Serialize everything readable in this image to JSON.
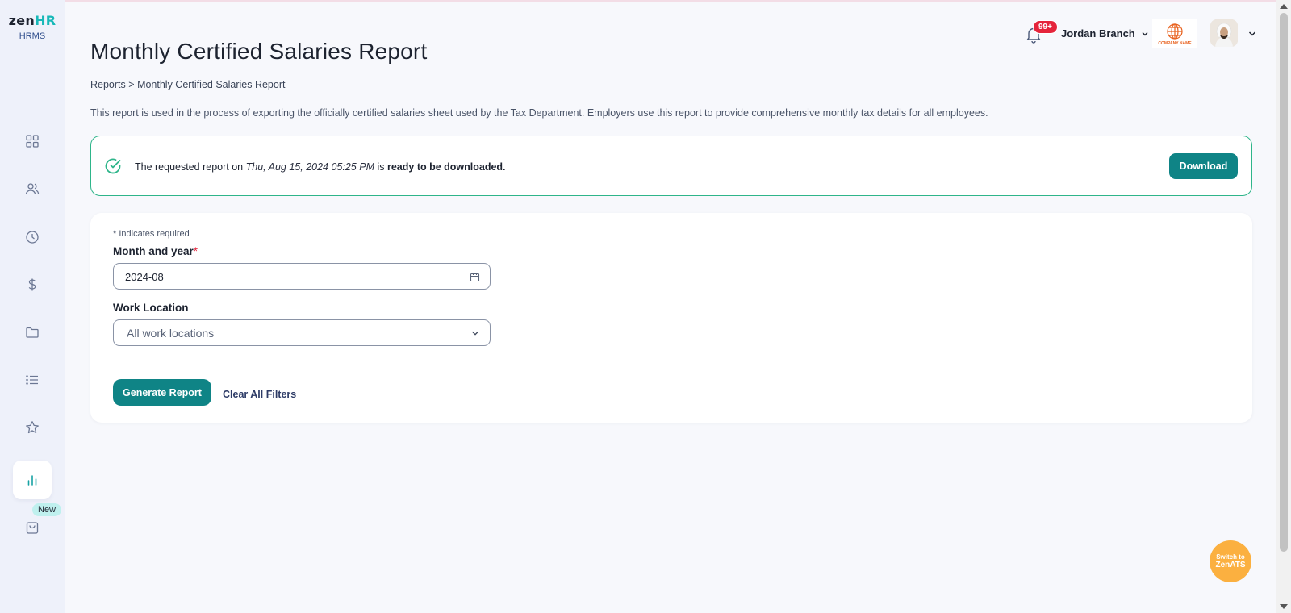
{
  "brand": {
    "name_prefix": "zen",
    "name_suffix": "HR",
    "product": "HRMS"
  },
  "sidebar": {
    "items": [
      {
        "icon": "dashboard-icon"
      },
      {
        "icon": "people-icon"
      },
      {
        "icon": "clock-icon"
      },
      {
        "icon": "dollar-icon"
      },
      {
        "icon": "folder-icon"
      },
      {
        "icon": "list-icon"
      },
      {
        "icon": "star-icon"
      },
      {
        "icon": "bar-chart-icon",
        "active": true
      },
      {
        "icon": "shopping-bag-icon",
        "badge": "New"
      }
    ],
    "new_badge": "New"
  },
  "header": {
    "notification_count": "99+",
    "branch": "Jordan Branch",
    "company_logo_text": "COMPANY NAME"
  },
  "page": {
    "title": "Monthly Certified Salaries Report",
    "breadcrumb": {
      "root": "Reports",
      "separator": ">",
      "current": "Monthly Certified Salaries Report"
    },
    "description": "This report is used in the process of exporting the officially certified salaries sheet used by the Tax Department. Employers use this report to provide comprehensive monthly tax details for all employees."
  },
  "alert": {
    "prefix": "The requested report on",
    "datetime": "Thu, Aug 15, 2024 05:25 PM",
    "middle": "is",
    "status": "ready to be downloaded.",
    "button": "Download",
    "accent": "#2eb58a"
  },
  "form": {
    "required_note": "* Indicates required",
    "month_label": "Month and year",
    "required_star": "*",
    "month_value": "2024-08",
    "location_label": "Work Location",
    "location_placeholder": "All work locations",
    "generate_button": "Generate Report",
    "clear_link": "Clear All Filters"
  },
  "switcher": {
    "line1": "Switch to",
    "line2": "ZenATS",
    "color": "#fbb040"
  },
  "colors": {
    "primary": "#0f8486",
    "danger": "#e5243b",
    "brand_accent": "#17b8b8"
  }
}
